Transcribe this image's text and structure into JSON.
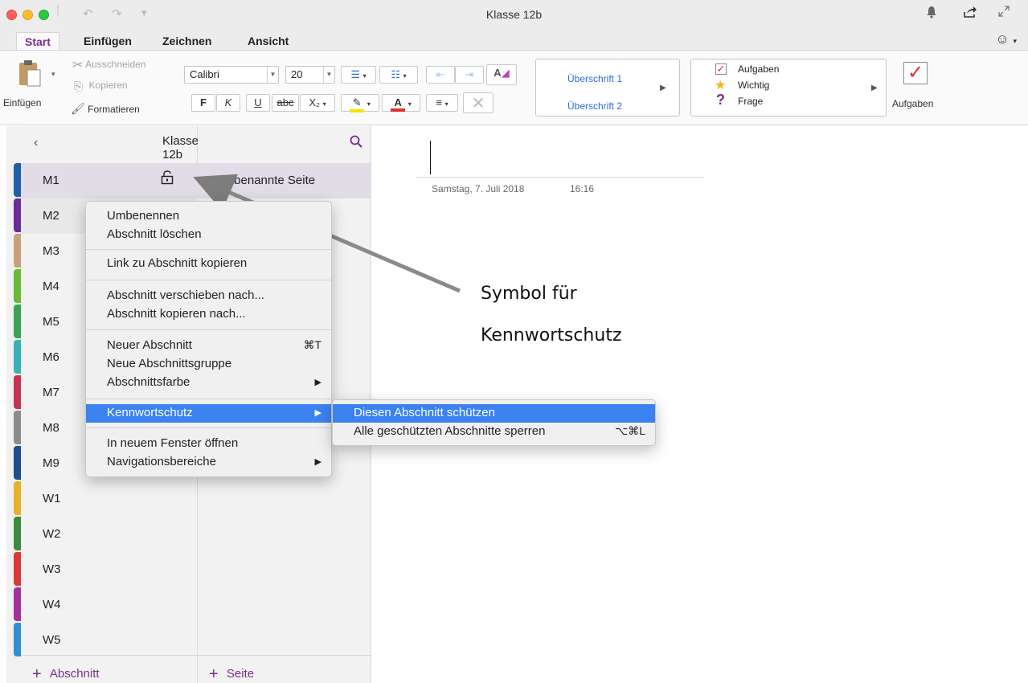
{
  "window": {
    "title": "Klasse 12b"
  },
  "icons": {
    "undo": "undo-icon",
    "redo": "redo-icon",
    "customize": "customize-icon",
    "bell": "bell-icon",
    "share": "share-icon",
    "fullscreen": "fullscreen-icon",
    "smiley": "smiley-icon",
    "lock": "lock-open-icon"
  },
  "tabs": [
    {
      "label": "Start",
      "active": true
    },
    {
      "label": "Einfügen"
    },
    {
      "label": "Zeichnen"
    },
    {
      "label": "Ansicht"
    }
  ],
  "ribbon": {
    "paste_label": "Einfügen",
    "cut_label": "Ausschneiden",
    "copy_label": "Kopieren",
    "format_label": "Formatieren",
    "font_name": "Calibri",
    "font_size": "20",
    "bold": "F",
    "italic": "K",
    "underline": "U",
    "strike": "abc",
    "subscript": "X₂",
    "styles": [
      "Überschrift 1",
      "Überschrift 2"
    ],
    "tags": [
      "Aufgaben",
      "Wichtig",
      "Frage"
    ],
    "todo_label": "Aufgaben"
  },
  "nav": {
    "title": "Klasse 12b",
    "sections": [
      "M1",
      "M2",
      "M3",
      "M4",
      "M5",
      "M6",
      "M7",
      "M8",
      "M9",
      "W1",
      "W2",
      "W3",
      "W4",
      "W5"
    ],
    "selected_section": "M1",
    "active_section": "M2",
    "add_section_label": "Abschnitt",
    "add_page_label": "Seite",
    "pages": [
      "Unbenannte Seite"
    ]
  },
  "note": {
    "date": "Samstag, 7. Juli 2018",
    "time": "16:16"
  },
  "context_menu": {
    "items": [
      {
        "label": "Umbenennen"
      },
      {
        "label": "Abschnitt löschen"
      },
      {
        "label": "Link zu Abschnitt kopieren"
      },
      {
        "label": "Abschnitt verschieben nach..."
      },
      {
        "label": "Abschnitt kopieren nach..."
      },
      {
        "label": "Neuer Abschnitt",
        "shortcut": "⌘T"
      },
      {
        "label": "Neue Abschnittsgruppe"
      },
      {
        "label": "Abschnittsfarbe",
        "submenu": true
      },
      {
        "label": "Kennwortschutz",
        "submenu": true,
        "highlighted": true
      },
      {
        "label": "In neuem Fenster öffnen"
      },
      {
        "label": "Navigationsbereiche",
        "submenu": true
      }
    ]
  },
  "submenu": {
    "items": [
      {
        "label": "Diesen Abschnitt schützen",
        "highlighted": true
      },
      {
        "label": "Alle geschützten Abschnitte sperren",
        "shortcut": "⌥⌘L"
      }
    ]
  },
  "annotation": {
    "line1": "Symbol für",
    "line2": "Kennwortschutz"
  },
  "colors": {
    "accent": "#7b2c8f",
    "menu_highlight": "#3b82f0",
    "section_tabs": [
      "#1e5fa8",
      "#6a2c9a",
      "#c8a27a",
      "#68b934",
      "#3aa355",
      "#3ab2b5",
      "#c63451",
      "#8c8c8c",
      "#1e4d8f",
      "#e6b32a",
      "#3c8a3f",
      "#d93a35",
      "#a43199",
      "#2f8fd0"
    ]
  }
}
